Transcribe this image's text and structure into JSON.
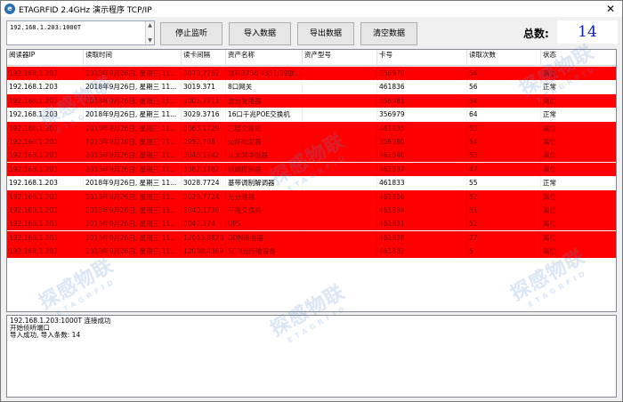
{
  "window": {
    "title": "ETAGRFID 2.4GHz 演示程序 TCP/IP",
    "close_glyph": "✕"
  },
  "connection": {
    "address": "192.168.1.203:1000T"
  },
  "toolbar": {
    "stop_label": "停止监听",
    "import_label": "导入数据",
    "export_label": "导出数据",
    "clear_label": "清空数据"
  },
  "summary": {
    "total_label": "总数:",
    "total_value": "14"
  },
  "table": {
    "columns": [
      "阅读器IP",
      "读取时间",
      "读卡间隔",
      "资产名称",
      "资产型号",
      "卡号",
      "读取次数",
      "状态"
    ],
    "rows": [
      {
        "status_type": "alarm",
        "cells": [
          "192.168.1.203",
          "2018年9月26日, 星期三  11...",
          "3078.7752",
          "思科3750 4351/89联...",
          "",
          "356978",
          "54",
          "离位"
        ]
      },
      {
        "status_type": "normal",
        "cells": [
          "192.168.1.203",
          "2018年9月26日, 星期三  11...",
          "3019.371",
          "8口网关",
          "",
          "461836",
          "56",
          "正常"
        ]
      },
      {
        "status_type": "alarm",
        "cells": [
          "192.168.1.203",
          "2018年9月26日, 星期三  11...",
          "3005.7711",
          "波分复用器",
          "",
          "356981",
          "54",
          "离位"
        ]
      },
      {
        "status_type": "normal",
        "cells": [
          "192.168.1.203",
          "2018年9月26日, 星期三  11...",
          "3029.3716",
          "16口千兆POE交换机",
          "",
          "356979",
          "64",
          "正常"
        ]
      },
      {
        "status_type": "alarm",
        "cells": [
          "192.168.1.203",
          "2018年9月26日, 星期三  11...",
          "3063.1729",
          "三层交换机",
          "",
          "461835",
          "53",
          "离位"
        ]
      },
      {
        "status_type": "alarm",
        "cells": [
          "192.168.1.203",
          "2018年9月26日, 星期三  11...",
          "2952.768",
          "光纤收发器",
          "",
          "356980",
          "54",
          "离位"
        ]
      },
      {
        "status_type": "alarm",
        "cells": [
          "192.168.1.203",
          "2018年9月26日, 星期三  11...",
          "3046.1742",
          "以太网中继器",
          "",
          "461840",
          "53",
          "离位"
        ]
      },
      {
        "status_type": "alarm",
        "cells": [
          "192.168.1.203",
          "2018年9月26日, 星期三  11...",
          "3082.1782",
          "机端控制器",
          "",
          "461837",
          "47",
          "离位"
        ]
      },
      {
        "status_type": "normal",
        "cells": [
          "192.168.1.203",
          "2018年9月26日, 星期三  11...",
          "3028.7724",
          "基带调制解调器",
          "",
          "461833",
          "55",
          "正常"
        ]
      },
      {
        "status_type": "alarm",
        "cells": [
          "192.168.1.203",
          "2018年9月26日, 星期三  11...",
          "3029.7724",
          "光分路器",
          "",
          "461836",
          "52",
          "离位"
        ]
      },
      {
        "status_type": "alarm",
        "cells": [
          "192.168.1.203",
          "2018年9月26日, 星期三  11...",
          "3040.1739",
          "千兆交换机",
          "",
          "461834",
          "51",
          "离位"
        ]
      },
      {
        "status_type": "alarm",
        "cells": [
          "192.168.1.203",
          "2018年9月26日, 星期三  11...",
          "3042.174",
          "UPS",
          "",
          "461831",
          "52",
          "离位"
        ]
      },
      {
        "status_type": "alarm",
        "cells": [
          "192.168.1.203",
          "2018年9月26日, 星期三  11...",
          "12043.8828",
          "DDN路由器",
          "",
          "461838",
          "27",
          "离位"
        ]
      },
      {
        "status_type": "alarm",
        "cells": [
          "192.168.1.203",
          "2018年9月26日, 星期三  11...",
          "12080.4369",
          "SDH光传输设备",
          "",
          "461832",
          "5",
          "离位"
        ]
      }
    ]
  },
  "log": {
    "lines": [
      "192.168.1.203:1000T 连接成功",
      "开始侦听端口",
      "导入成功, 导入条数: 14"
    ]
  },
  "watermark": {
    "text": "探感物联",
    "sub": "ETAGRFID"
  },
  "colors": {
    "alarm_row": "#ff0000",
    "normal_row": "#ffffff",
    "total_value": "#1020b0"
  }
}
